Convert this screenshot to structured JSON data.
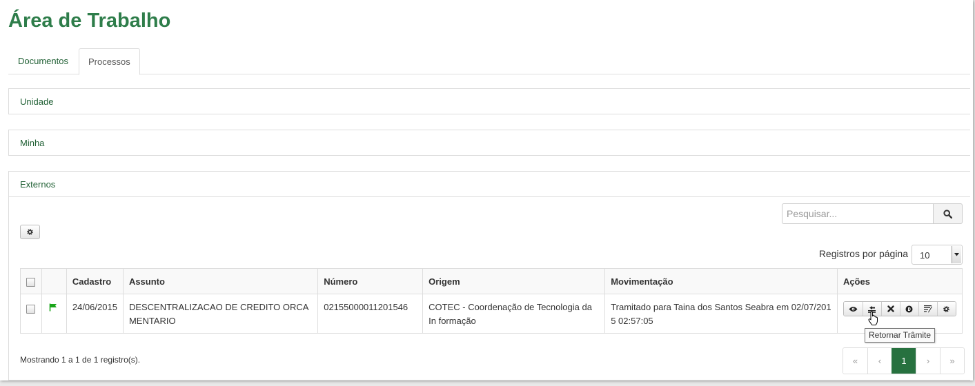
{
  "page": {
    "title": "Área de Trabalho"
  },
  "tabs": [
    {
      "label": "Documentos",
      "active": false
    },
    {
      "label": "Processos",
      "active": true
    }
  ],
  "panels": {
    "unidade": "Unidade",
    "minha": "Minha",
    "externos": "Externos"
  },
  "search": {
    "placeholder": "Pesquisar..."
  },
  "per_page": {
    "label": "Registros por página",
    "value": "10"
  },
  "table": {
    "headers": [
      "Cadastro",
      "Assunto",
      "Número",
      "Origem",
      "Movimentação",
      "Ações"
    ],
    "rows": [
      {
        "cadastro": "24/06/2015",
        "assunto": "DESCENTRALIZACAO DE CREDITO ORCA MENTARIO",
        "numero": "02155000011201546",
        "origem": "COTEC - Coordenação de Tecnologia da In formação",
        "movimentacao": "Tramitado para Taina dos Santos Seabra em 02/07/201 5 02:57:05",
        "flag_color": "#1aa51a",
        "actions": [
          "eye-icon",
          "return-icon",
          "close-icon",
          "circle-d-icon",
          "notes-icon",
          "gear-icon"
        ]
      }
    ]
  },
  "tooltip": "Retornar Trâmite",
  "footer": {
    "showing": "Mostrando 1 a 1 de 1 registro(s)."
  },
  "pagination": {
    "first": "«",
    "prev": "‹",
    "current": "1",
    "next": "›",
    "last": "»"
  },
  "colors": {
    "brand_green": "#2e7d4a",
    "active_page": "#27713f"
  }
}
